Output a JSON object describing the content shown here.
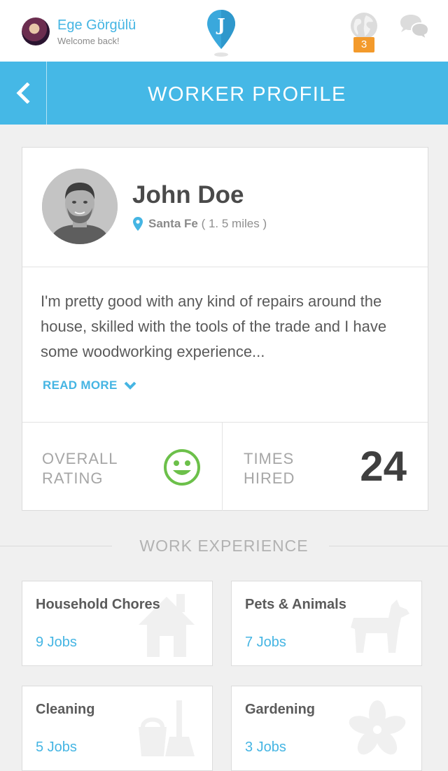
{
  "topbar": {
    "user_name": "Ege Görgülü",
    "welcome": "Welcome back!",
    "notification_count": "3",
    "accent": "#45b5e3",
    "badge_color": "#f39a2b"
  },
  "header": {
    "title": "WORKER PROFILE",
    "color": "#45b8e6"
  },
  "profile": {
    "name": "John Doe",
    "city": "Santa Fe",
    "distance": "( 1. 5 miles )",
    "bio": "I'm pretty good with any kind of repairs around the house, skilled with the tools of the trade and I have some woodworking experience...",
    "read_more": "READ MORE",
    "rating_label": "OVERALL RATING",
    "hired_label": "TIMES HIRED",
    "times_hired": "24"
  },
  "work_experience": {
    "title": "WORK EXPERIENCE",
    "categories": [
      {
        "title": "Household Chores",
        "jobs": "9 Jobs",
        "icon": "house-icon"
      },
      {
        "title": "Pets & Animals",
        "jobs": "7 Jobs",
        "icon": "dog-icon"
      },
      {
        "title": "Cleaning",
        "jobs": "5 Jobs",
        "icon": "cleaning-icon"
      },
      {
        "title": "Gardening",
        "jobs": "3 Jobs",
        "icon": "flower-icon"
      }
    ]
  }
}
